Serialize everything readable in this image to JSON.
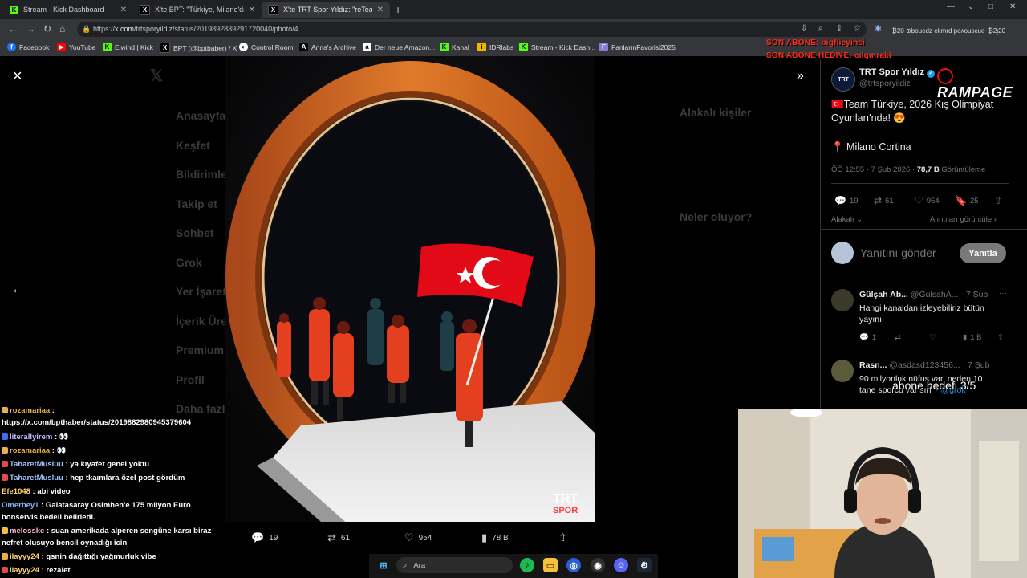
{
  "browser": {
    "tabs": [
      {
        "label": "Stream - Kick Dashboard",
        "icon": "kick-icon"
      },
      {
        "label": "X'te BPT: \"Türkiye, Milano'daki K",
        "icon": "x-icon"
      },
      {
        "label": "X'te TRT Spor Yıldız: \"reTeam Tü",
        "icon": "x-icon"
      }
    ],
    "url_prefix": "https://",
    "url_host": "x.com",
    "url_path": "/trtsporyildiz/status/2019892839291720040/photo/4",
    "bookmarks": [
      {
        "label": "Facebook",
        "icon": "facebook-icon"
      },
      {
        "label": "YouTube",
        "icon": "youtube-icon"
      },
      {
        "label": "Elwind | Kick",
        "icon": "kick-icon"
      },
      {
        "label": "BPT (@bptbaber) / X",
        "icon": "x-icon"
      },
      {
        "label": "Control Room",
        "icon": "control-room-icon"
      },
      {
        "label": "Anna's Archive",
        "icon": "annas-archive-icon"
      },
      {
        "label": "Der neue Amazon...",
        "icon": "amazon-icon"
      },
      {
        "label": "Kanal",
        "icon": "kick-icon"
      },
      {
        "label": "IDRlabs",
        "icon": "idrlabs-icon"
      },
      {
        "label": "Stream - Kick Dash...",
        "icon": "kick-icon"
      },
      {
        "label": "FanlarınFavorisi2025",
        "icon": "fanlar-icon"
      }
    ],
    "sys_text_1": "₿20 ⊕bouedz ekmrd poʌouscue",
    "sys_text_2": "₿2ᴉ20"
  },
  "overlay": {
    "sub_line_1": "SON ABONE: bigflieyinsi",
    "sub_line_2": "SON ABONE HEDİYE: cılgınraki",
    "brand": "RAMPAGE",
    "goal": "abone hedefi 3/5"
  },
  "x_bg_nav": [
    "Anasayfa",
    "Keşfet",
    "Bildirimler",
    "Takip et",
    "Sohbet",
    "Grok",
    "Yer İşaretleri",
    "İçerik Üretici",
    "Premium",
    "Profil",
    "Daha fazla"
  ],
  "x_bg_right": {
    "related": "Alakalı kişiler",
    "happening": "Neler oluyor?"
  },
  "photo": {
    "watermark_1": "TRT",
    "watermark_2": "SPOR",
    "replies": "19",
    "retweets": "61",
    "likes": "954",
    "views": "78 B"
  },
  "tweet": {
    "author": "TRT Spor Yıldız",
    "handle": "@trtsporyildiz",
    "text_1": "🇹🇷Team Türkiye, 2026 Kış Olimpiyat Oyunları'nda! 😍",
    "text_2": "📍 Milano Cortina",
    "time": "ÖÖ 12:55 · 7 Şub 2026 · ",
    "views_count": "78,7 B",
    "views_label": " Görüntüleme",
    "replies": "19",
    "retweets": "61",
    "likes": "954",
    "bookmarks": "25",
    "sort_label": "Alakalı",
    "quotes_label": "Alıntıları görüntüle",
    "reply_placeholder": "Yanıtını gönder",
    "reply_button": "Yanıtla"
  },
  "replies": [
    {
      "name": "Gülşah Ab...",
      "handle": "@GulsahA...",
      "date": "· 7 Şub",
      "text": "Hangi kanaldan izleyebiliriz bütün yayını",
      "replies": "1",
      "views": "1 B"
    },
    {
      "name": "Rasn...",
      "handle": "@asdasd123456...",
      "date": "· 7 Şub",
      "text": "90 milyonluk nüfus var, neden 10 tane sporcu var sırf ? ",
      "mention": "@grok"
    }
  ],
  "chat": [
    {
      "user": "rozamariaa",
      "msg": " :",
      "color": "#e8b04b"
    },
    {
      "user": "",
      "msg": "https://x.com/bpthaber/status/2019882980945379604",
      "color": "#ffffff"
    },
    {
      "user": "literallyirem",
      "msg": " : 👀",
      "color": "#c7b6ff"
    },
    {
      "user": "rozamariaa",
      "msg": " : 👀",
      "color": "#e8b04b"
    },
    {
      "user": "TaharetMusluu",
      "msg": " : ya kıyafet genel yoktu",
      "color": "#9ec6ff"
    },
    {
      "user": "TaharetMusluu",
      "msg": " : hep tkaımlara özel post gördüm",
      "color": "#9ec6ff"
    },
    {
      "user": "Efe1048",
      "msg": " : abi video",
      "color": "#ffd36b"
    },
    {
      "user": "Omerbey1",
      "msg": " : Galatasaray Osimhen'e 175 milyon Euro",
      "color": "#7fb6ff"
    },
    {
      "user": "",
      "msg": "bonservis bedeli belirledi.",
      "color": "#ffffff"
    },
    {
      "user": "melosske",
      "msg": " : suan amerikada alperen sengüne karsı biraz",
      "color": "#ffb0d8"
    },
    {
      "user": "",
      "msg": "nefret olusuyo bencil oynadığı icin",
      "color": "#ffffff"
    },
    {
      "user": "ilayyy24",
      "msg": " : gsnin dağıttığı yağmurluk vibe",
      "color": "#ffd36b"
    },
    {
      "user": "ilayyy24",
      "msg": " : rezalet",
      "color": "#ffd36b"
    }
  ],
  "taskbar": {
    "search_label": "Ara"
  },
  "colors": {
    "accent": "#1d9bf0",
    "kick": "#53fc18",
    "flag_red": "#e30a17",
    "suit_red": "#e4401f",
    "ring_orange": "#d2631a"
  }
}
